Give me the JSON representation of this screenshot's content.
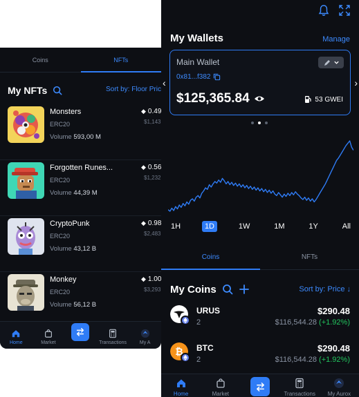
{
  "left": {
    "tabs": [
      {
        "label": "Coins"
      },
      {
        "label": "NFTs"
      }
    ],
    "title": "My NFTs",
    "sort_label": "Sort by: Floor Pric",
    "nfts": [
      {
        "name": "Monsters",
        "chain": "ERC20",
        "volume_label": "Volume",
        "volume": "593,00 M",
        "price": "0.49",
        "usd": "$1,143"
      },
      {
        "name": "Forgotten Runes...",
        "chain": "ERC20",
        "volume_label": "Volume",
        "volume": "44,39 M",
        "price": "0.56",
        "usd": "$1,232"
      },
      {
        "name": "CryptoPunk",
        "chain": "ERC20",
        "volume_label": "Volume",
        "volume": "43,12 B",
        "price": "0.98",
        "usd": "$2,483"
      },
      {
        "name": "Monkey",
        "chain": "ERC20",
        "volume_label": "Volume",
        "volume": "56,12 B",
        "price": "1.00",
        "usd": "$3,293"
      }
    ],
    "nav": [
      {
        "label": "Home",
        "icon": "home-icon"
      },
      {
        "label": "Market",
        "icon": "bag-icon"
      },
      {
        "label": "",
        "icon": "swap-icon"
      },
      {
        "label": "Transactions",
        "icon": "calculator-icon"
      },
      {
        "label": "My A",
        "icon": "avatar-icon"
      }
    ]
  },
  "right": {
    "title": "My Wallets",
    "manage": "Manage",
    "wallet": {
      "name": "Main Wallet",
      "address": "0x81...f382",
      "balance": "$125,365.84",
      "gas": "53 GWEI"
    },
    "ranges": [
      "1H",
      "1D",
      "1W",
      "1M",
      "1Y",
      "All"
    ],
    "active_range": "1D",
    "tabs": [
      {
        "label": "Coins"
      },
      {
        "label": "NFTs"
      }
    ],
    "coins_title": "My Coins",
    "sort_label": "Sort by: Price ↓",
    "coins": [
      {
        "name": "URUS",
        "qty": "2",
        "price": "$290.48",
        "value": "$116,544.28",
        "change": "(+1.92%)"
      },
      {
        "name": "BTC",
        "qty": "2",
        "price": "$290.48",
        "value": "$116,544.28",
        "change": "(+1.92%)"
      }
    ],
    "nav": [
      {
        "label": "Home"
      },
      {
        "label": "Market"
      },
      {
        "label": ""
      },
      {
        "label": "Transactions"
      },
      {
        "label": "My Aurox"
      }
    ]
  },
  "colors": {
    "accent": "#2f7cf6",
    "background": "#0d0f14",
    "positive": "#22c55e"
  },
  "chart_data": {
    "type": "line",
    "x": [
      0,
      1,
      2,
      3,
      4,
      5,
      6,
      7,
      8,
      9,
      10,
      11,
      12,
      13,
      14,
      15,
      16,
      17,
      18,
      19,
      20,
      21,
      22,
      23,
      24,
      25,
      26,
      27,
      28,
      29,
      30,
      31,
      32,
      33,
      34,
      35,
      36,
      37,
      38,
      39,
      40,
      41,
      42,
      43,
      44,
      45,
      46,
      47,
      48,
      49,
      50,
      51,
      52,
      53,
      54,
      55,
      56,
      57,
      58,
      59,
      60,
      61,
      62,
      63,
      64,
      65,
      66,
      67,
      68,
      69,
      70,
      71,
      72,
      73,
      74,
      75,
      76,
      77,
      78,
      79,
      80,
      81,
      82,
      83,
      84,
      85,
      86,
      87,
      88,
      89,
      90,
      91,
      92,
      93,
      94,
      95,
      96,
      97,
      98,
      99
    ],
    "values": [
      12,
      10,
      14,
      11,
      16,
      13,
      18,
      15,
      20,
      17,
      22,
      19,
      24,
      26,
      23,
      28,
      30,
      27,
      33,
      36,
      40,
      38,
      44,
      41,
      45,
      48,
      46,
      50,
      47,
      52,
      49,
      45,
      48,
      44,
      47,
      43,
      46,
      42,
      45,
      41,
      44,
      40,
      43,
      39,
      42,
      38,
      41,
      37,
      40,
      36,
      39,
      35,
      38,
      34,
      37,
      33,
      36,
      32,
      30,
      34,
      31,
      28,
      32,
      29,
      33,
      30,
      34,
      31,
      35,
      32,
      30,
      27,
      25,
      28,
      24,
      27,
      23,
      26,
      22,
      25,
      29,
      33,
      37,
      41,
      45,
      50,
      55,
      60,
      65,
      70,
      75,
      78,
      82,
      86,
      90,
      94,
      97,
      100,
      92,
      88
    ],
    "xlabel": "",
    "ylabel": ""
  }
}
